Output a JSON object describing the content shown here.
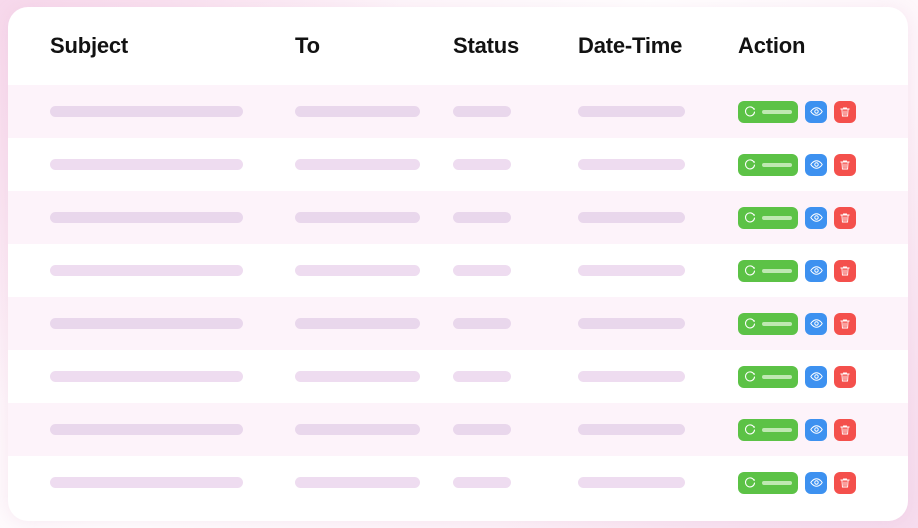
{
  "theme": {
    "page_bg": "#fdf3f9",
    "card_bg": "#ffffff",
    "stripe_bg": "#fdf3fa",
    "skeleton_color": "#eedcf0",
    "header_text_color": "#121212",
    "resend_button_color": "#5cc246",
    "view_button_color": "#3d91f0",
    "delete_button_color": "#f4504c"
  },
  "table": {
    "columns": [
      {
        "key": "subject",
        "label": "Subject"
      },
      {
        "key": "to",
        "label": "To"
      },
      {
        "key": "status",
        "label": "Status"
      },
      {
        "key": "datetime",
        "label": "Date-Time"
      },
      {
        "key": "action",
        "label": "Action"
      }
    ],
    "loading": true,
    "row_count": 8,
    "rows": [
      {
        "striped": true,
        "subject": "",
        "to": "",
        "status": "",
        "datetime": ""
      },
      {
        "striped": false,
        "subject": "",
        "to": "",
        "status": "",
        "datetime": ""
      },
      {
        "striped": true,
        "subject": "",
        "to": "",
        "status": "",
        "datetime": ""
      },
      {
        "striped": false,
        "subject": "",
        "to": "",
        "status": "",
        "datetime": ""
      },
      {
        "striped": true,
        "subject": "",
        "to": "",
        "status": "",
        "datetime": ""
      },
      {
        "striped": false,
        "subject": "",
        "to": "",
        "status": "",
        "datetime": ""
      },
      {
        "striped": true,
        "subject": "",
        "to": "",
        "status": "",
        "datetime": ""
      },
      {
        "striped": false,
        "subject": "",
        "to": "",
        "status": "",
        "datetime": ""
      }
    ],
    "row_actions": [
      {
        "name": "resend-button",
        "icon": "refresh-icon",
        "label": "",
        "color": "#5cc246"
      },
      {
        "name": "view-button",
        "icon": "eye-icon",
        "label": "",
        "color": "#3d91f0"
      },
      {
        "name": "delete-button",
        "icon": "trash-icon",
        "label": "",
        "color": "#f4504c"
      }
    ]
  }
}
